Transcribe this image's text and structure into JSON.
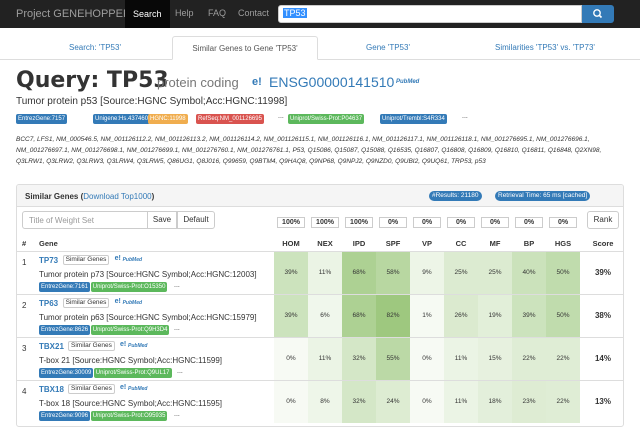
{
  "navbar": {
    "brand": "Project GENEHOPPER",
    "links": [
      "Search",
      "Help",
      "FAQ",
      "Contact"
    ],
    "search_value": "TP53"
  },
  "tabs": [
    "Search: 'TP53'",
    "Similar Genes to Gene 'TP53'",
    "Gene 'TP53'",
    "Similarities 'TP53' vs. 'TP73'"
  ],
  "query": {
    "title": "Query: TP53",
    "type": "protein coding",
    "ensembl": "ENSG00000141510",
    "pub_label": "PubMed",
    "description": "Tumor protein p53 [Source:HGNC Symbol;Acc:HGNC:11998]",
    "badges": [
      {
        "text": "EntrezGene:7157",
        "color": "#337ab7"
      },
      {
        "text": "Unigene:Hs.437460",
        "color": "#337ab7"
      },
      {
        "text": "HGNC:11998",
        "color": "#f0ad4e"
      },
      {
        "text": "RefSeq:NM_001126695",
        "color": "#d9534f"
      },
      {
        "text": "...",
        "color": ""
      },
      {
        "text": "Uniprot/Swiss-Prot:P04637",
        "color": "#5cb85c"
      },
      {
        "text": "Uniprot/Trembl:S4R334",
        "color": "#337ab7"
      },
      {
        "text": "...",
        "color": ""
      }
    ],
    "accessions": "BCC7, LFS1, NM_000546.5, NM_001126112.2, NM_001126113.2, NM_001126114.2, NM_001126115.1, NM_001126116.1, NM_001126117.1, NM_001126118.1, NM_001276695.1, NM_001276696.1, NM_001276697.1, NM_001276698.1, NM_001276699.1, NM_001276760.1, NM_001276761.1, P53, Q15086, Q15087, Q15088, Q16535, Q16807, Q16808, Q16809, Q16810, Q16811, Q16848, Q2XN98, Q3LRW1, Q3LRW2, Q3LRW3, Q3LRW4, Q3LRW5, Q86UG1, Q8J016, Q99659, Q9BTM4, Q9HAQ8, Q9NP68, Q9NPJ2, Q9NZD0, Q9UBI2, Q9UQ61, TRP53, p53"
  },
  "panel": {
    "title": "Similar Genes",
    "download_link": "Download Top1000",
    "results_badge": "#Results: 21180",
    "time_badge": "Retrieval Time: 65 ms [cached]",
    "weight_placeholder": "Title of Weight Set",
    "save_label": "Save",
    "default_label": "Default",
    "rank_label": "Rank",
    "weights": [
      "100%",
      "100%",
      "100%",
      "0%",
      "0%",
      "0%",
      "0%",
      "0%",
      "0%"
    ],
    "columns": [
      "#",
      "Gene",
      "HOM",
      "NEX",
      "IPD",
      "SPF",
      "VP",
      "CC",
      "MF",
      "BP",
      "HGS",
      "Score"
    ],
    "similar_btn": "Similar Genes",
    "rows": [
      {
        "num": "1",
        "symbol": "TP73",
        "desc": "Tumor protein p73 [Source:HGNC Symbol;Acc:HGNC:12003]",
        "badges": [
          {
            "text": "EntrezGene:7161",
            "color": "#337ab7"
          },
          {
            "text": "Uniprot/Swiss-Prot:O15350",
            "color": "#5cb85c"
          }
        ],
        "values": [
          "39%",
          "11%",
          "68%",
          "58%",
          "9%",
          "25%",
          "25%",
          "40%",
          "50%"
        ],
        "shades": [
          0.39,
          0.11,
          0.68,
          0.58,
          0.09,
          0.25,
          0.25,
          0.4,
          0.5
        ],
        "score": "39%"
      },
      {
        "num": "2",
        "symbol": "TP63",
        "desc": "Tumor protein p63 [Source:HGNC Symbol;Acc:HGNC:15979]",
        "badges": [
          {
            "text": "EntrezGene:8626",
            "color": "#337ab7"
          },
          {
            "text": "Uniprot/Swiss-Prot:Q9H3D4",
            "color": "#5cb85c"
          }
        ],
        "values": [
          "39%",
          "6%",
          "68%",
          "82%",
          "1%",
          "26%",
          "19%",
          "39%",
          "50%"
        ],
        "shades": [
          0.39,
          0.06,
          0.68,
          0.82,
          0.01,
          0.26,
          0.19,
          0.39,
          0.5
        ],
        "score": "38%"
      },
      {
        "num": "3",
        "symbol": "TBX21",
        "desc": "T-box 21 [Source:HGNC Symbol;Acc:HGNC:11599]",
        "badges": [
          {
            "text": "EntrezGene:30009",
            "color": "#337ab7"
          },
          {
            "text": "Uniprot/Swiss-Prot:Q9UL17",
            "color": "#5cb85c"
          }
        ],
        "values": [
          "0%",
          "11%",
          "32%",
          "55%",
          "0%",
          "11%",
          "15%",
          "22%",
          "22%"
        ],
        "shades": [
          0,
          0.11,
          0.32,
          0.55,
          0,
          0.11,
          0.15,
          0.22,
          0.22
        ],
        "score": "14%"
      },
      {
        "num": "4",
        "symbol": "TBX18",
        "desc": "T-box 18 [Source:HGNC Symbol;Acc:HGNC:11595]",
        "badges": [
          {
            "text": "EntrezGene:9096",
            "color": "#337ab7"
          },
          {
            "text": "Uniprot/Swiss-Prot:O95935",
            "color": "#5cb85c"
          }
        ],
        "values": [
          "0%",
          "8%",
          "32%",
          "24%",
          "0%",
          "11%",
          "18%",
          "23%",
          "22%"
        ],
        "shades": [
          0,
          0.08,
          0.32,
          0.24,
          0,
          0.11,
          0.18,
          0.23,
          0.22
        ],
        "score": "13%"
      }
    ]
  }
}
